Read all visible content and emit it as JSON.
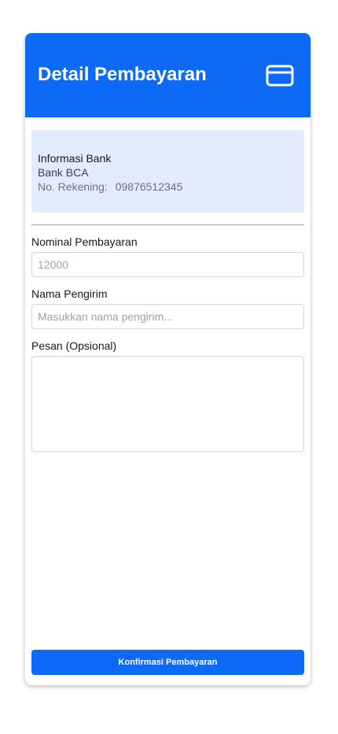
{
  "header": {
    "title": "Detail Pembayaran",
    "icon": "credit-card-icon",
    "background": "#0d6af6"
  },
  "bank_info": {
    "title": "Informasi Bank",
    "bank_name": "Bank BCA",
    "account_label": "No. Rekening:",
    "account_number": "09876512345",
    "background": "#e2ecfd"
  },
  "form": {
    "amount": {
      "label": "Nominal Pembayaran",
      "placeholder": "12000"
    },
    "sender": {
      "label": "Nama Pengirim",
      "placeholder": "Masukkan nama pengirim..."
    },
    "message": {
      "label": "Pesan (Opsional)",
      "placeholder": ""
    }
  },
  "confirm_button": {
    "label": "Konfirmasi Pembayaran",
    "color": "#0d6af6"
  }
}
